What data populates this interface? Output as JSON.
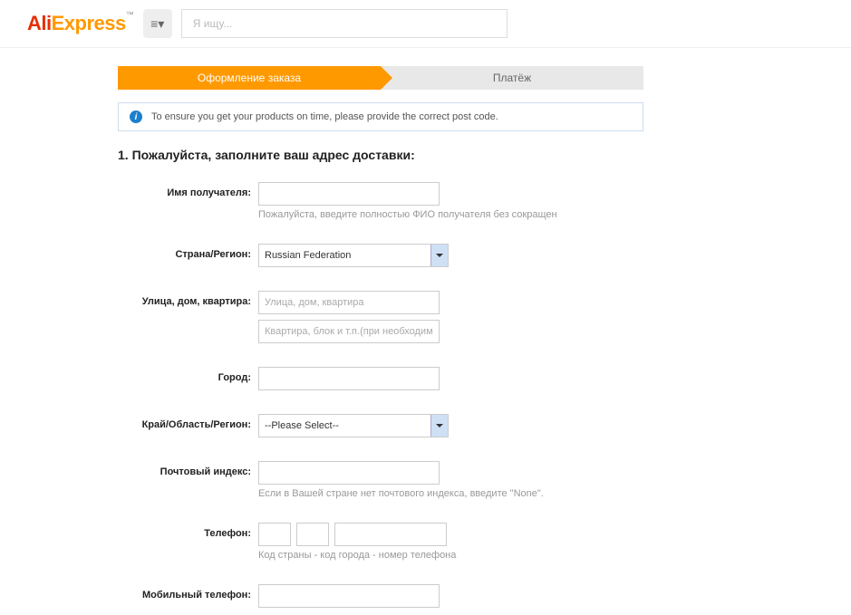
{
  "header": {
    "logo_ali": "Ali",
    "logo_express": "Express",
    "logo_tm": "™",
    "menu_glyph": "≡▾",
    "search_placeholder": "Я ищу..."
  },
  "steps": {
    "active": "Оформление заказа",
    "next": "Платёж"
  },
  "info": {
    "text": "To ensure you get your products on time, please provide the correct post code."
  },
  "section_title": "1. Пожалуйста, заполните ваш адрес доставки:",
  "form": {
    "recipient": {
      "label": "Имя получателя:",
      "hint": "Пожалуйста, введите полностью ФИО получателя без сокращен"
    },
    "country": {
      "label": "Страна/Регион:",
      "value": "Russian Federation"
    },
    "street": {
      "label": "Улица, дом, квартира:",
      "placeholder1": "Улица, дом, квартира",
      "placeholder2": "Квартира, блок и т.п.(при необходимос"
    },
    "city": {
      "label": "Город:"
    },
    "region": {
      "label": "Край/Область/Регион:",
      "value": "--Please Select--"
    },
    "postcode": {
      "label": "Почтовый индекс:",
      "hint": "Если в Вашей стране нет почтового индекса, введите \"None\"."
    },
    "phone": {
      "label": "Телефон:",
      "hint": "Код страны - код города - номер телефона"
    },
    "mobile": {
      "label": "Мобильный телефон:"
    }
  }
}
